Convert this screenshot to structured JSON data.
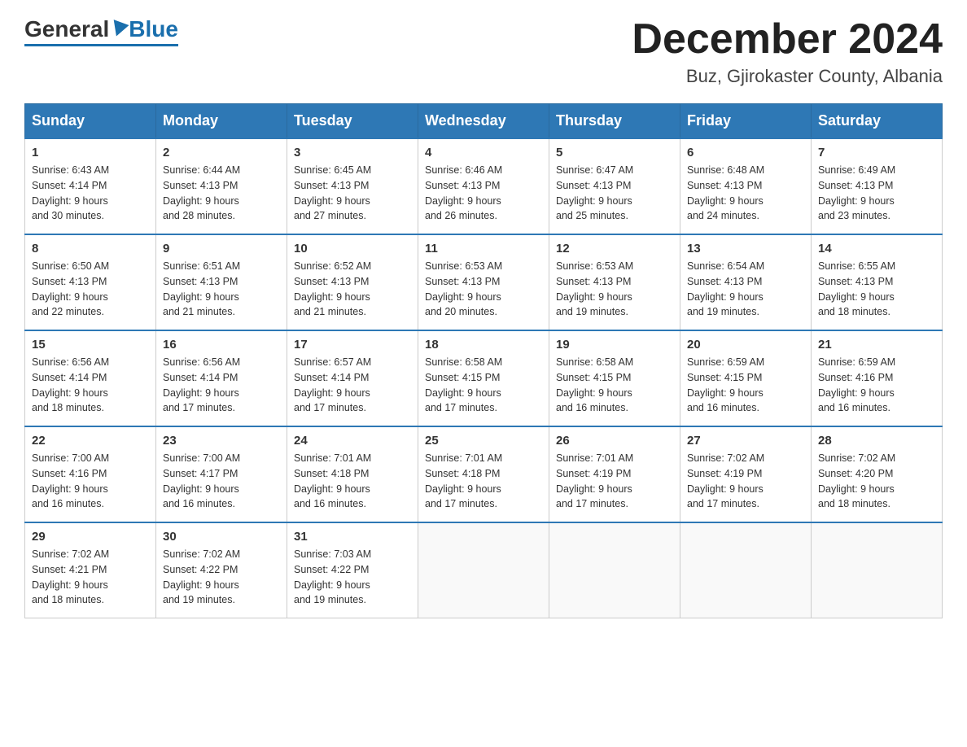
{
  "header": {
    "logo": {
      "text1": "General",
      "text2": "Blue"
    },
    "title": "December 2024",
    "subtitle": "Buz, Gjirokaster County, Albania"
  },
  "days_of_week": [
    "Sunday",
    "Monday",
    "Tuesday",
    "Wednesday",
    "Thursday",
    "Friday",
    "Saturday"
  ],
  "weeks": [
    [
      {
        "day": "1",
        "sunrise": "6:43 AM",
        "sunset": "4:14 PM",
        "daylight": "9 hours and 30 minutes."
      },
      {
        "day": "2",
        "sunrise": "6:44 AM",
        "sunset": "4:13 PM",
        "daylight": "9 hours and 28 minutes."
      },
      {
        "day": "3",
        "sunrise": "6:45 AM",
        "sunset": "4:13 PM",
        "daylight": "9 hours and 27 minutes."
      },
      {
        "day": "4",
        "sunrise": "6:46 AM",
        "sunset": "4:13 PM",
        "daylight": "9 hours and 26 minutes."
      },
      {
        "day": "5",
        "sunrise": "6:47 AM",
        "sunset": "4:13 PM",
        "daylight": "9 hours and 25 minutes."
      },
      {
        "day": "6",
        "sunrise": "6:48 AM",
        "sunset": "4:13 PM",
        "daylight": "9 hours and 24 minutes."
      },
      {
        "day": "7",
        "sunrise": "6:49 AM",
        "sunset": "4:13 PM",
        "daylight": "9 hours and 23 minutes."
      }
    ],
    [
      {
        "day": "8",
        "sunrise": "6:50 AM",
        "sunset": "4:13 PM",
        "daylight": "9 hours and 22 minutes."
      },
      {
        "day": "9",
        "sunrise": "6:51 AM",
        "sunset": "4:13 PM",
        "daylight": "9 hours and 21 minutes."
      },
      {
        "day": "10",
        "sunrise": "6:52 AM",
        "sunset": "4:13 PM",
        "daylight": "9 hours and 21 minutes."
      },
      {
        "day": "11",
        "sunrise": "6:53 AM",
        "sunset": "4:13 PM",
        "daylight": "9 hours and 20 minutes."
      },
      {
        "day": "12",
        "sunrise": "6:53 AM",
        "sunset": "4:13 PM",
        "daylight": "9 hours and 19 minutes."
      },
      {
        "day": "13",
        "sunrise": "6:54 AM",
        "sunset": "4:13 PM",
        "daylight": "9 hours and 19 minutes."
      },
      {
        "day": "14",
        "sunrise": "6:55 AM",
        "sunset": "4:13 PM",
        "daylight": "9 hours and 18 minutes."
      }
    ],
    [
      {
        "day": "15",
        "sunrise": "6:56 AM",
        "sunset": "4:14 PM",
        "daylight": "9 hours and 18 minutes."
      },
      {
        "day": "16",
        "sunrise": "6:56 AM",
        "sunset": "4:14 PM",
        "daylight": "9 hours and 17 minutes."
      },
      {
        "day": "17",
        "sunrise": "6:57 AM",
        "sunset": "4:14 PM",
        "daylight": "9 hours and 17 minutes."
      },
      {
        "day": "18",
        "sunrise": "6:58 AM",
        "sunset": "4:15 PM",
        "daylight": "9 hours and 17 minutes."
      },
      {
        "day": "19",
        "sunrise": "6:58 AM",
        "sunset": "4:15 PM",
        "daylight": "9 hours and 16 minutes."
      },
      {
        "day": "20",
        "sunrise": "6:59 AM",
        "sunset": "4:15 PM",
        "daylight": "9 hours and 16 minutes."
      },
      {
        "day": "21",
        "sunrise": "6:59 AM",
        "sunset": "4:16 PM",
        "daylight": "9 hours and 16 minutes."
      }
    ],
    [
      {
        "day": "22",
        "sunrise": "7:00 AM",
        "sunset": "4:16 PM",
        "daylight": "9 hours and 16 minutes."
      },
      {
        "day": "23",
        "sunrise": "7:00 AM",
        "sunset": "4:17 PM",
        "daylight": "9 hours and 16 minutes."
      },
      {
        "day": "24",
        "sunrise": "7:01 AM",
        "sunset": "4:18 PM",
        "daylight": "9 hours and 16 minutes."
      },
      {
        "day": "25",
        "sunrise": "7:01 AM",
        "sunset": "4:18 PM",
        "daylight": "9 hours and 17 minutes."
      },
      {
        "day": "26",
        "sunrise": "7:01 AM",
        "sunset": "4:19 PM",
        "daylight": "9 hours and 17 minutes."
      },
      {
        "day": "27",
        "sunrise": "7:02 AM",
        "sunset": "4:19 PM",
        "daylight": "9 hours and 17 minutes."
      },
      {
        "day": "28",
        "sunrise": "7:02 AM",
        "sunset": "4:20 PM",
        "daylight": "9 hours and 18 minutes."
      }
    ],
    [
      {
        "day": "29",
        "sunrise": "7:02 AM",
        "sunset": "4:21 PM",
        "daylight": "9 hours and 18 minutes."
      },
      {
        "day": "30",
        "sunrise": "7:02 AM",
        "sunset": "4:22 PM",
        "daylight": "9 hours and 19 minutes."
      },
      {
        "day": "31",
        "sunrise": "7:03 AM",
        "sunset": "4:22 PM",
        "daylight": "9 hours and 19 minutes."
      },
      null,
      null,
      null,
      null
    ]
  ],
  "labels": {
    "sunrise": "Sunrise:",
    "sunset": "Sunset:",
    "daylight": "Daylight:"
  }
}
